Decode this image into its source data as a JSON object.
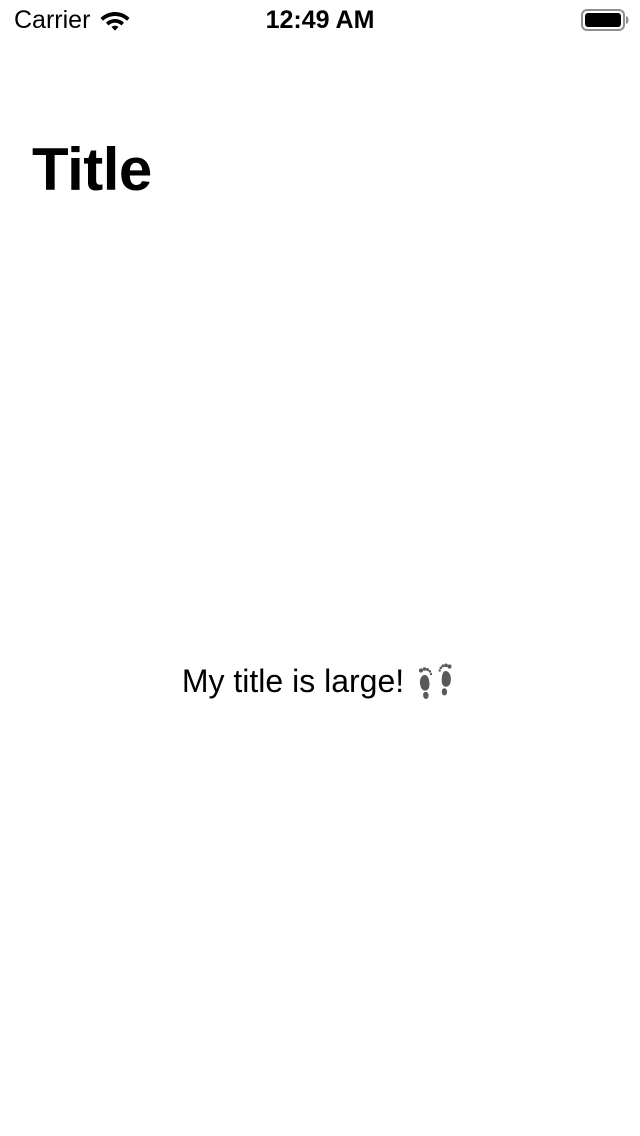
{
  "status_bar": {
    "carrier": "Carrier",
    "time": "12:49 AM",
    "wifi_icon": "wifi-icon",
    "battery_icon": "battery-icon",
    "battery_level": 1.0
  },
  "navigation": {
    "large_title": "Title"
  },
  "content": {
    "label": "My title is large!",
    "icon": "footprints-icon"
  },
  "colors": {
    "background": "#ffffff",
    "text": "#000000",
    "icon_gray": "#595959"
  }
}
